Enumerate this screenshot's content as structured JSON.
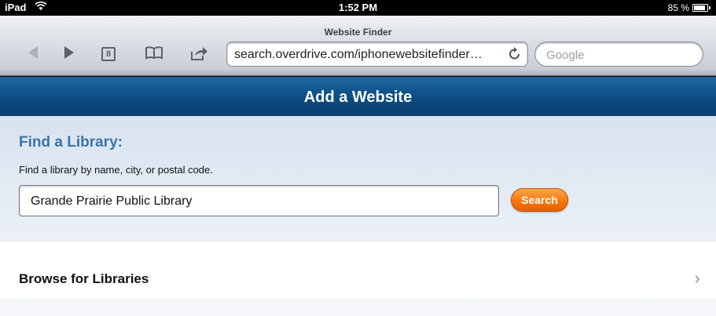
{
  "status_bar": {
    "device": "iPad",
    "time": "1:52 PM",
    "battery": "85 %",
    "wifi_icon": "wifi-icon",
    "battery_icon": "battery-icon"
  },
  "browser": {
    "title": "Website Finder",
    "url": "search.overdrive.com/iphonewebsitefinder…",
    "search_placeholder": "Google",
    "tab_count": "8",
    "icons": {
      "back": "◀",
      "forward": "▶",
      "bookmarks": "📖",
      "share": "⇗",
      "reload": "↻"
    }
  },
  "page": {
    "header_title": "Add a Website",
    "find": {
      "title": "Find a Library:",
      "description": "Find a library by name, city, or postal code.",
      "input_value": "Grande Prairie Public Library",
      "search_label": "Search"
    },
    "browse": {
      "label": "Browse for Libraries",
      "chevron": "›"
    }
  },
  "colors": {
    "header": "#0c4c82",
    "find_title": "#3c72a8",
    "search_button": "#f7780e"
  }
}
